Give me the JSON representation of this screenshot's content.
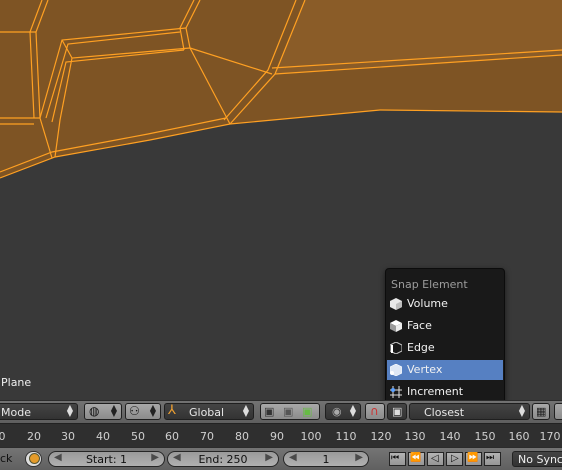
{
  "viewport": {
    "object_label": "Plane",
    "mesh_color": "#7e5424",
    "edge_color": "#ffa022",
    "background_color": "#393939"
  },
  "snap_menu": {
    "title": "Snap Element",
    "items": [
      {
        "label": "Volume",
        "icon": "volume-cube-icon",
        "selected": false
      },
      {
        "label": "Face",
        "icon": "face-cube-icon",
        "selected": false
      },
      {
        "label": "Edge",
        "icon": "edge-cube-icon",
        "selected": false
      },
      {
        "label": "Vertex",
        "icon": "vertex-cube-icon",
        "selected": true
      },
      {
        "label": "Increment",
        "icon": "increment-grid-icon",
        "selected": false
      }
    ],
    "selected_color": "#5680c2"
  },
  "header": {
    "mode_label": "Mode",
    "orientation_label": "Global",
    "snap_target_label": "Closest"
  },
  "ruler": {
    "ticks": [
      "0",
      "20",
      "30",
      "40",
      "50",
      "60",
      "70",
      "80",
      "90",
      "100",
      "110",
      "120",
      "130",
      "140",
      "150",
      "160",
      "170"
    ]
  },
  "playbar": {
    "left_label": "ck",
    "start_label": "Start: 1",
    "end_label": "End: 250",
    "current_frame": "1",
    "sync_label": "No Sync"
  }
}
